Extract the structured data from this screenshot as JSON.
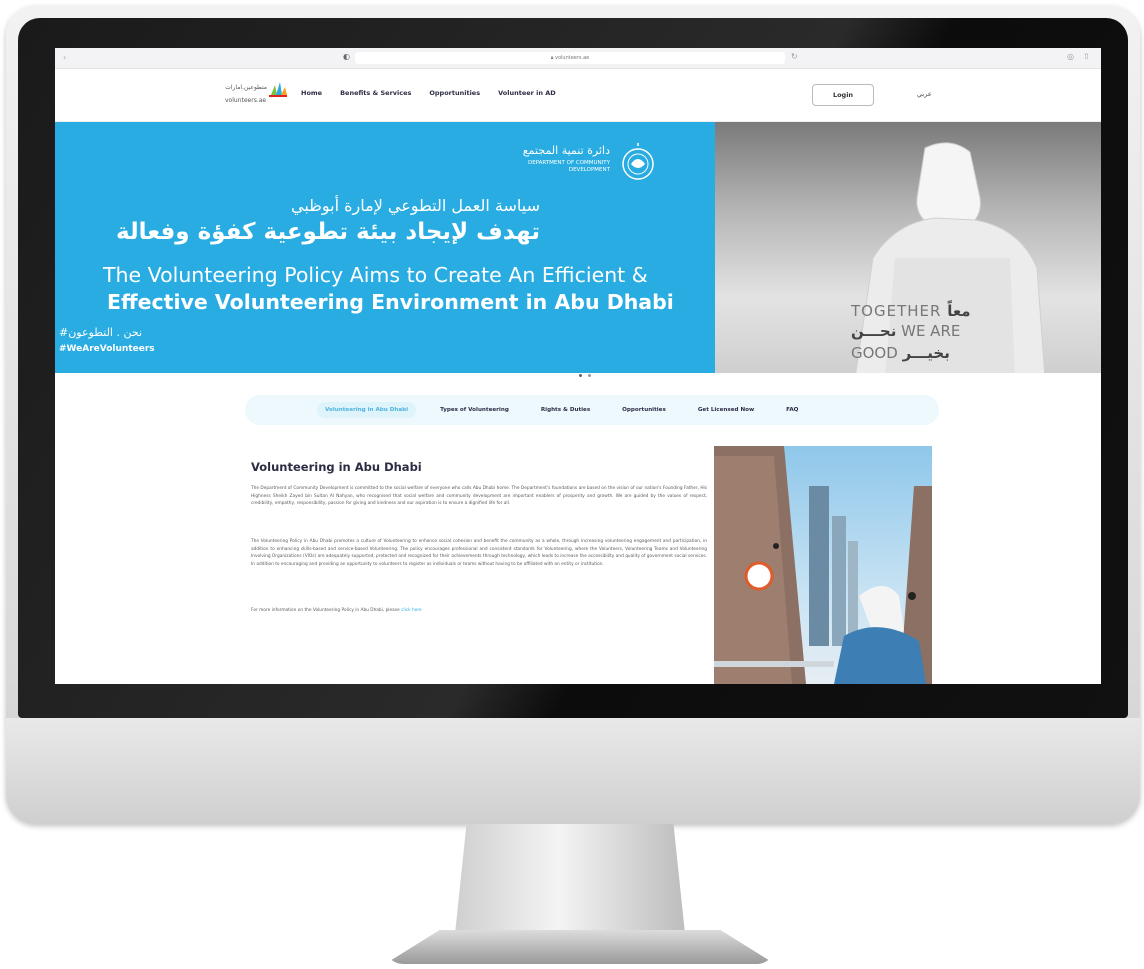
{
  "browser": {
    "url": "volunteers.ae"
  },
  "nav": {
    "logo_ar": "متطوعين.امارات",
    "logo_en": "volunteers.ae",
    "links": [
      "Home",
      "Benefits & Services",
      "Opportunities",
      "Volunteer in AD"
    ],
    "login": "Login",
    "lang": "عربي"
  },
  "hero": {
    "dept_ar": "دائرة تنمية المجتمع",
    "dept_en": "DEPARTMENT OF COMMUNITY DEVELOPMENT",
    "ar_line1": "سياسة العمل التطوعي لإمارة أبوظبي",
    "ar_line2": "تهدف لإيجاد بيئة تطوعية كفؤة وفعالة",
    "en_line1": "The Volunteering Policy Aims to Create An Efficient &",
    "en_line2": "Effective Volunteering Environment in Abu Dhabi",
    "hashtag_ar": "#نحن . التطوعون",
    "hashtag_en": "#WeAreVolunteers",
    "slogan_line1_en": "TOGETHER",
    "slogan_line1_ar": "معاً",
    "slogan_line2_en": "WE ARE",
    "slogan_line2_ar": "نحـــن",
    "slogan_line3_en": "GOOD",
    "slogan_line3_ar": "بخيـــر"
  },
  "tabs": [
    "Volunteering in Abu Dhabi",
    "Types of Volunteering",
    "Rights & Duties",
    "Opportunities",
    "Get Licensed Now",
    "FAQ"
  ],
  "content": {
    "title": "Volunteering in Abu Dhabi",
    "para1": "The Department of Community Development is committed to the social welfare of everyone who calls Abu Dhabi home. The Department's foundations are based on the vision of our nation's Founding Father, His Highness Sheikh Zayed bin Sultan Al Nahyan, who recognised that social welfare and community development are important enablers of prosperity and growth. We are guided by the values of respect, credibility, empathy, responsibility, passion for giving and kindness and our aspiration is to ensure a dignified life for all.",
    "para2": "The Volunteering Policy in Abu Dhabi promotes a culture of Volunteering to enhance social cohesion and benefit the community as a whole, through increasing volunteering engagement and participation, in addition to enhancing skills-based and service-based Volunteering. The policy encourages professional and consistent standards for Volunteering, where the Volunteers, Volunteering Teams and Volunteering Involving Organizations (VIOs) are adequately supported, protected and recognized for their achievements through technology, which leads to increase the accessibility and quality of government social services. In addition to encouraging and providing an opportunity to volunteers to register as individuals or teams without having to be affiliated with an entity or institution.",
    "para3": "For more information on the Volunteering Policy in Abu Dhabi, please",
    "para3_link": "click here"
  },
  "colors": {
    "hero_blue": "#29ace2",
    "tab_active": "#4fb3df",
    "nav_text": "#2c2c44"
  }
}
